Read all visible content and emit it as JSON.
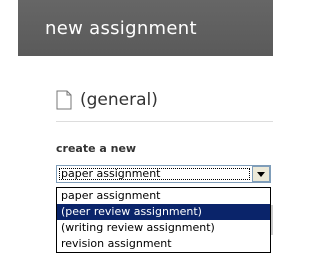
{
  "header": {
    "title": "new assignment"
  },
  "section": {
    "icon": "document-icon",
    "title": "(general)"
  },
  "form": {
    "create_label": "create a new",
    "select": {
      "value": "paper assignment",
      "options": [
        "paper assignment",
        "(peer review assignment)",
        "(writing review assignment)",
        "revision assignment"
      ],
      "highlighted_index": 1
    }
  },
  "colors": {
    "header_bg": "#5f5f5f",
    "highlight": "#0a246a",
    "select_border": "#7f9db9"
  }
}
